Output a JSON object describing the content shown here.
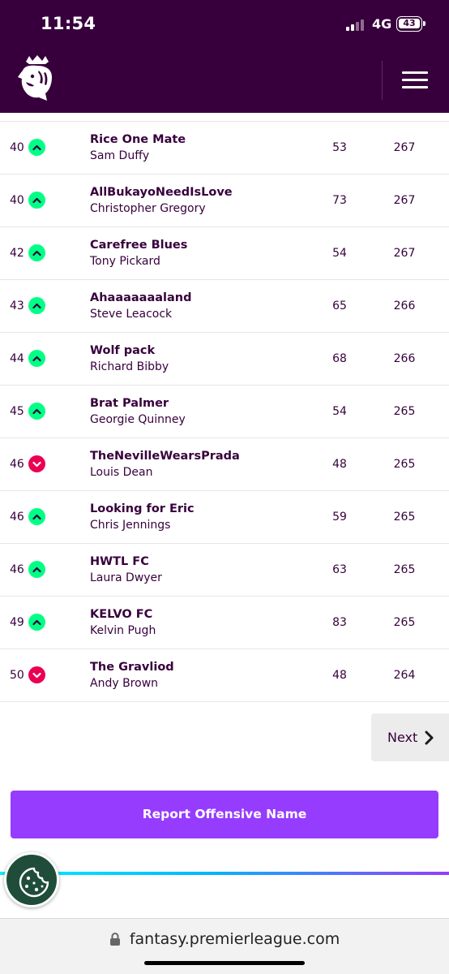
{
  "status_bar": {
    "time": "11:54",
    "network": "4G",
    "battery": "43"
  },
  "nav": {
    "logo_icon": "premier-league-lion-icon",
    "menu_icon": "hamburger-menu-icon"
  },
  "colors": {
    "brand_purple": "#37003c",
    "up_green": "#00ff85",
    "down_pink": "#e90052",
    "accent_violet": "#963cff"
  },
  "standings": [
    {
      "rank": "40",
      "movement": "up",
      "team": "Rice One Mate",
      "manager": "Sam Duffy",
      "gw": "53",
      "total": "267"
    },
    {
      "rank": "40",
      "movement": "up",
      "team": "AllBukayoNeedIsLove",
      "manager": "Christopher Gregory",
      "gw": "73",
      "total": "267"
    },
    {
      "rank": "42",
      "movement": "up",
      "team": "Carefree Blues",
      "manager": "Tony Pickard",
      "gw": "54",
      "total": "267"
    },
    {
      "rank": "43",
      "movement": "up",
      "team": "Ahaaaaaaaland",
      "manager": "Steve Leacock",
      "gw": "65",
      "total": "266"
    },
    {
      "rank": "44",
      "movement": "up",
      "team": "Wolf pack",
      "manager": "Richard Bibby",
      "gw": "68",
      "total": "266"
    },
    {
      "rank": "45",
      "movement": "up",
      "team": "Brat Palmer",
      "manager": "Georgie Quinney",
      "gw": "54",
      "total": "265"
    },
    {
      "rank": "46",
      "movement": "down",
      "team": "TheNevilleWearsPrada",
      "manager": "Louis Dean",
      "gw": "48",
      "total": "265"
    },
    {
      "rank": "46",
      "movement": "up",
      "team": "Looking for Eric",
      "manager": "Chris Jennings",
      "gw": "59",
      "total": "265"
    },
    {
      "rank": "46",
      "movement": "up",
      "team": "HWTL FC",
      "manager": "Laura Dwyer",
      "gw": "63",
      "total": "265"
    },
    {
      "rank": "49",
      "movement": "up",
      "team": "KELVO FC",
      "manager": "Kelvin Pugh",
      "gw": "83",
      "total": "265"
    },
    {
      "rank": "50",
      "movement": "down",
      "team": "The Gravliod",
      "manager": "Andy Brown",
      "gw": "48",
      "total": "264"
    }
  ],
  "pagination": {
    "next_label": "Next"
  },
  "report_button": {
    "label": "Report Offensive Name"
  },
  "browser": {
    "url": "fantasy.premierleague.com"
  }
}
